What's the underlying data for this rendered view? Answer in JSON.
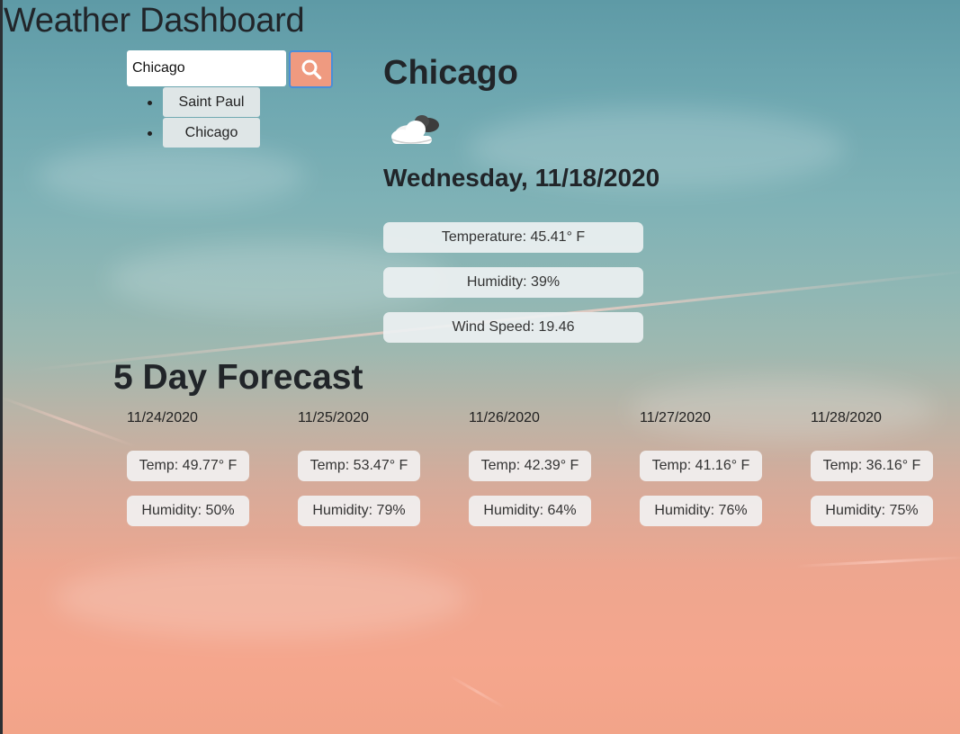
{
  "page": {
    "title": "Weather Dashboard"
  },
  "search": {
    "value": "Chicago",
    "button_icon": "search-icon"
  },
  "history": [
    {
      "label": "Saint Paul"
    },
    {
      "label": "Chicago"
    }
  ],
  "current": {
    "city": "Chicago",
    "icon": "partly-cloudy-icon",
    "date": "Wednesday, 11/18/2020",
    "temperature": "Temperature: 45.41° F",
    "humidity": "Humidity: 39%",
    "wind_speed": "Wind Speed: 19.46"
  },
  "forecast": {
    "title": "5 Day Forecast",
    "days": [
      {
        "date": "11/24/2020",
        "temp": "Temp: 49.77° F",
        "humidity": "Humidity: 50%"
      },
      {
        "date": "11/25/2020",
        "temp": "Temp: 53.47° F",
        "humidity": "Humidity: 79%"
      },
      {
        "date": "11/26/2020",
        "temp": "Temp: 42.39° F",
        "humidity": "Humidity: 64%"
      },
      {
        "date": "11/27/2020",
        "temp": "Temp: 41.16° F",
        "humidity": "Humidity: 76%"
      },
      {
        "date": "11/28/2020",
        "temp": "Temp: 36.16° F",
        "humidity": "Humidity: 75%"
      }
    ]
  },
  "colors": {
    "search_button": "#ef9a80",
    "search_button_border": "#4a8ed8",
    "pill_background": "#ecf0f1"
  }
}
